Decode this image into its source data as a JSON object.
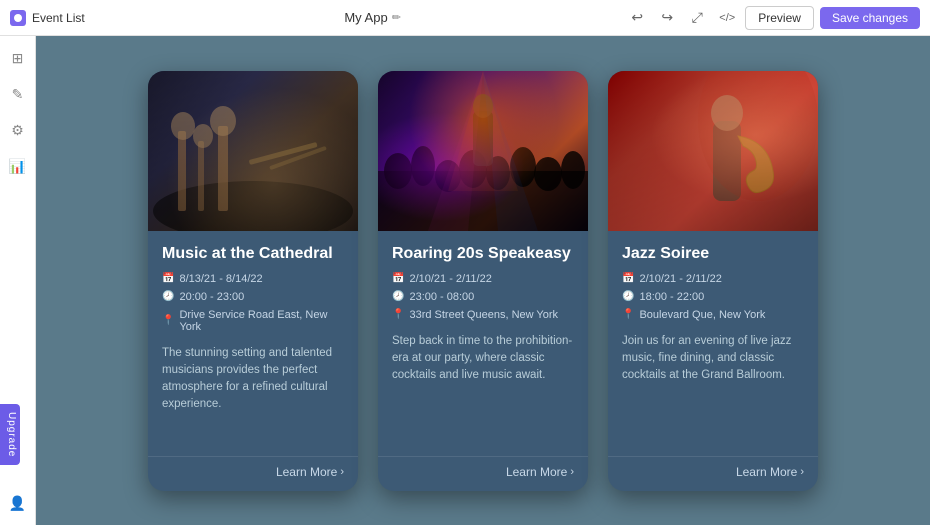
{
  "topbar": {
    "app_name": "Event List",
    "center_title": "My App",
    "edit_icon": "✏️",
    "preview_label": "Preview",
    "save_label": "Save changes"
  },
  "sidebar": {
    "items": [
      {
        "icon": "⊞",
        "name": "grid-icon"
      },
      {
        "icon": "✏",
        "name": "edit-icon"
      },
      {
        "icon": "⚙",
        "name": "settings-icon"
      },
      {
        "icon": "📊",
        "name": "chart-icon"
      }
    ],
    "upgrade_label": "Upgrade"
  },
  "events": [
    {
      "id": "music-cathedral",
      "title": "Music at the Cathedral",
      "date": "8/13/21 - 8/14/22",
      "time": "20:00 - 23:00",
      "location": "Drive Service Road East, New York",
      "description": "The stunning setting and talented musicians provides the perfect atmosphere for a refined cultural experience.",
      "learn_more": "Learn More",
      "image_class": "img-orchestra"
    },
    {
      "id": "roaring-20s",
      "title": "Roaring 20s Speakeasy",
      "date": "2/10/21 - 2/11/22",
      "time": "23:00 - 08:00",
      "location": "33rd Street Queens, New York",
      "description": "Step back in time to the prohibition-era at our party, where classic cocktails and live music await.",
      "learn_more": "Learn More",
      "image_class": "img-concert"
    },
    {
      "id": "jazz-soiree",
      "title": "Jazz Soiree",
      "date": "2/10/21 - 2/11/22",
      "time": "18:00 - 22:00",
      "location": "Boulevard Que, New York",
      "description": "Join us for an evening of live jazz music, fine dining, and classic cocktails at the Grand Ballroom.",
      "learn_more": "Learn More",
      "image_class": "img-jazz"
    }
  ]
}
